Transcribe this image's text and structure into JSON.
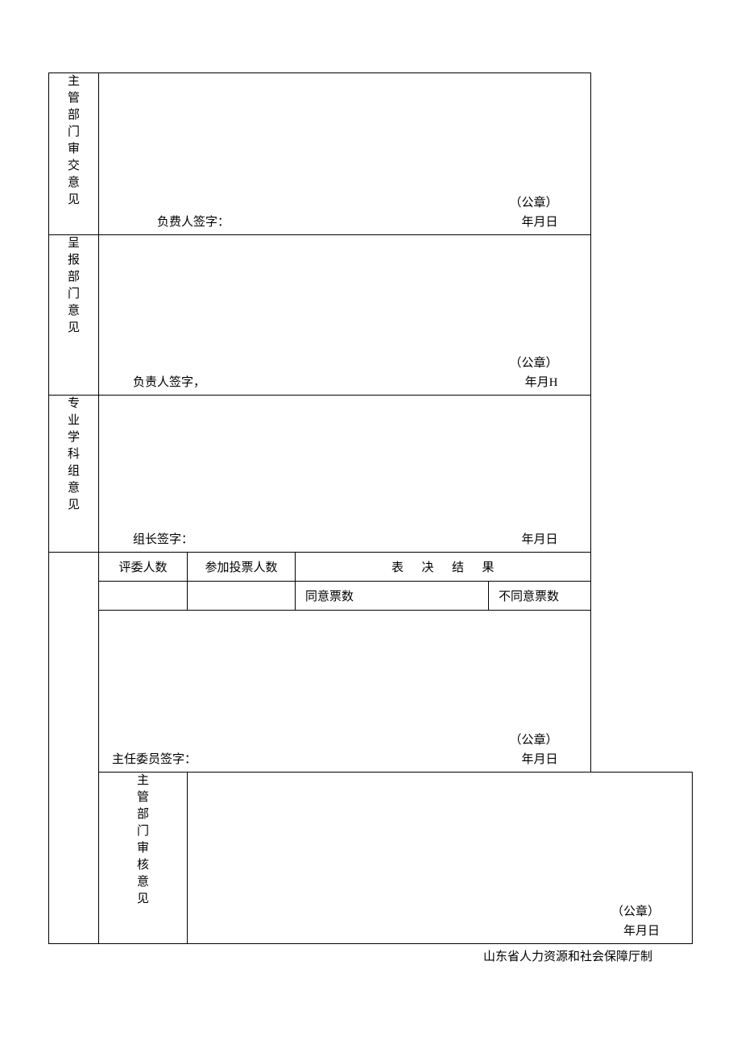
{
  "rows": {
    "r1": {
      "label": "主管部门审交意见",
      "signer": "负费人签字：",
      "seal": "（公章）",
      "date": "年月日"
    },
    "r2": {
      "label": "呈报部门意见",
      "signer": "负责人签字，",
      "seal": "（公章）",
      "date": "年月H"
    },
    "r3": {
      "label": "专业学科组意见",
      "signer": "组长签字：",
      "seal": "",
      "date": "年月日"
    },
    "vote": {
      "judges": "评委人数",
      "participants": "参加投票人数",
      "result": "表决结果",
      "agree": "同意票数",
      "disagree": "不同意票数"
    },
    "r5": {
      "signer": "主任委员签字：",
      "seal": "（公章）",
      "date": "年月日"
    },
    "r6": {
      "label": "主管部门审核意见",
      "seal": "（公章）",
      "date": "年月日"
    }
  },
  "footer": "山东省人力资源和社会保障厅制"
}
